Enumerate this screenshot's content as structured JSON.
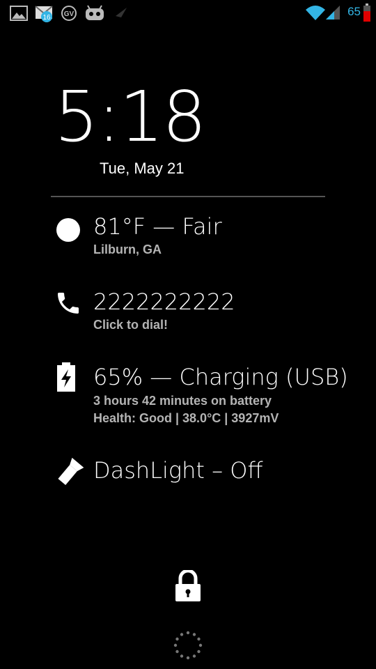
{
  "status_bar": {
    "icons": [
      "gallery-icon",
      "gmail-icon",
      "google-voice-icon",
      "cyanogenmod-icon",
      "send-icon",
      "wifi-icon",
      "signal-icon"
    ],
    "gmail_badge": "16",
    "google_voice_label": "GV",
    "battery_percent": "65",
    "battery_level": 0.65,
    "accent_color": "#33b5e5",
    "battery_color": "#e00000"
  },
  "clock": {
    "time": "5:18",
    "date": "Tue, May 21"
  },
  "widgets": [
    {
      "icon": "sun-icon",
      "title": "81°F — Fair",
      "subtitle": "Lilburn, GA"
    },
    {
      "icon": "phone-icon",
      "title": "2222222222",
      "subtitle": "Click to dial!"
    },
    {
      "icon": "battery-charging-icon",
      "title": "65% — Charging (USB)",
      "subtitle": "3 hours 42 minutes on battery",
      "subtitle2": "Health: Good | 38.0°C | 3927mV"
    },
    {
      "icon": "flashlight-icon",
      "title": "DashLight – Off"
    }
  ],
  "lockscreen": {
    "unlock_icon": "padlock-icon",
    "loading_icon": "spinner-icon"
  }
}
